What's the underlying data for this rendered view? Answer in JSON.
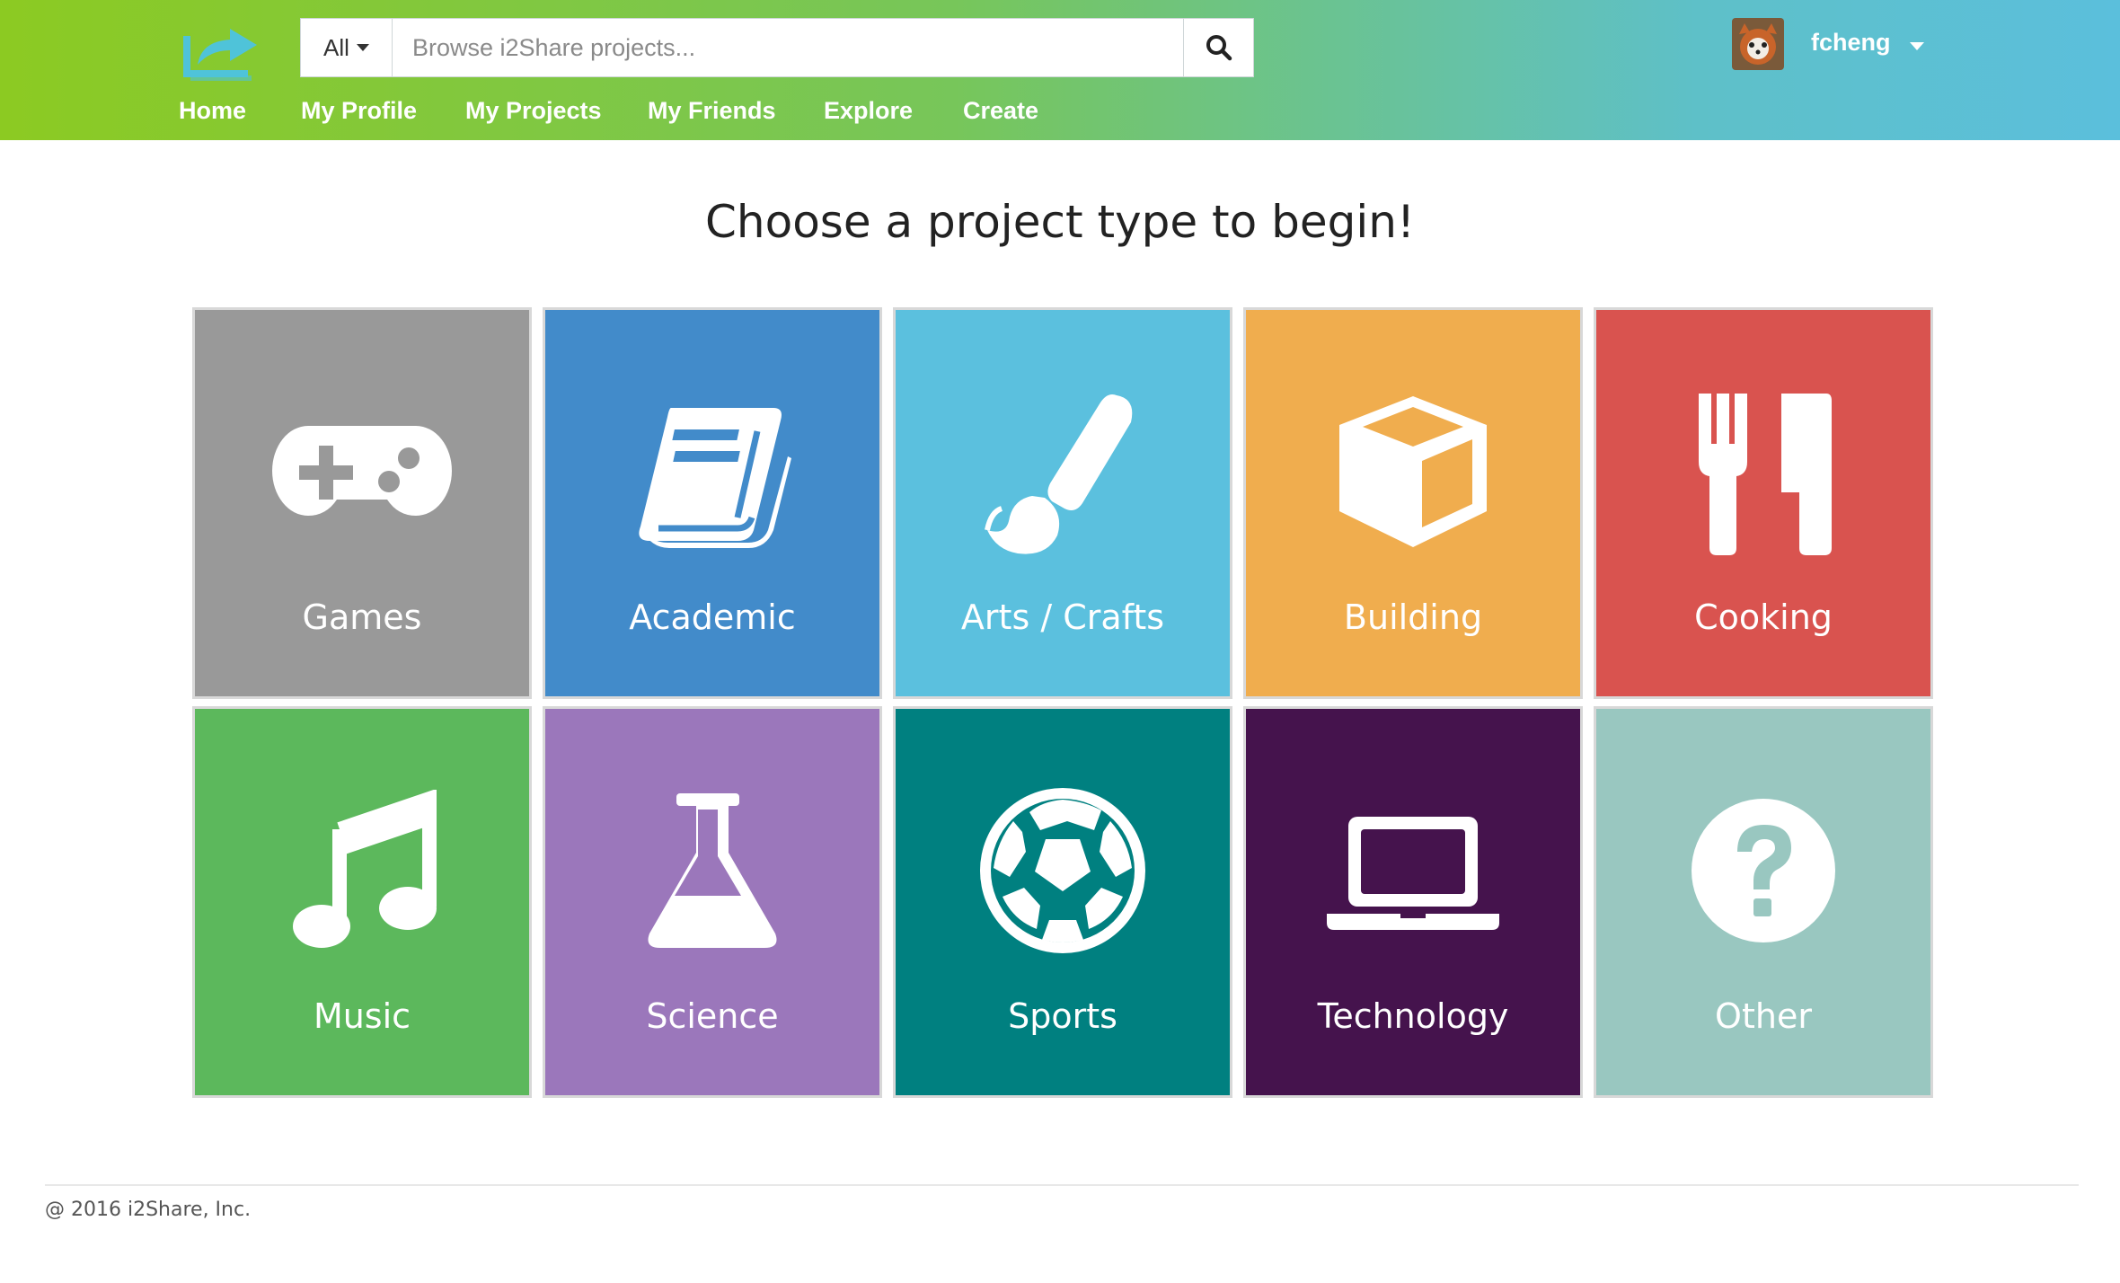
{
  "header": {
    "search": {
      "scope_label": "All",
      "placeholder": "Browse i2Share projects..."
    },
    "nav": [
      "Home",
      "My Profile",
      "My Projects",
      "My Friends",
      "Explore",
      "Create"
    ],
    "user": {
      "name": "fcheng"
    }
  },
  "main": {
    "heading": "Choose a project type to begin!",
    "tiles": [
      {
        "label": "Games",
        "icon": "gamepad-icon",
        "color": "#999999"
      },
      {
        "label": "Academic",
        "icon": "book-icon",
        "color": "#428bca"
      },
      {
        "label": "Arts / Crafts",
        "icon": "paintbrush-icon",
        "color": "#5bc0de"
      },
      {
        "label": "Building",
        "icon": "cube-icon",
        "color": "#f0ad4e"
      },
      {
        "label": "Cooking",
        "icon": "cutlery-icon",
        "color": "#d9534f"
      },
      {
        "label": "Music",
        "icon": "music-note-icon",
        "color": "#5cb85c"
      },
      {
        "label": "Science",
        "icon": "flask-icon",
        "color": "#9b77bb"
      },
      {
        "label": "Sports",
        "icon": "soccer-ball-icon",
        "color": "#008080"
      },
      {
        "label": "Technology",
        "icon": "laptop-icon",
        "color": "#45134d"
      },
      {
        "label": "Other",
        "icon": "question-icon",
        "color": "#99c7c0"
      }
    ]
  },
  "footer": {
    "copyright": "@ 2016 i2Share, Inc."
  },
  "colors": {
    "header_start": "#8cca22",
    "header_end": "#5bbfdc"
  }
}
